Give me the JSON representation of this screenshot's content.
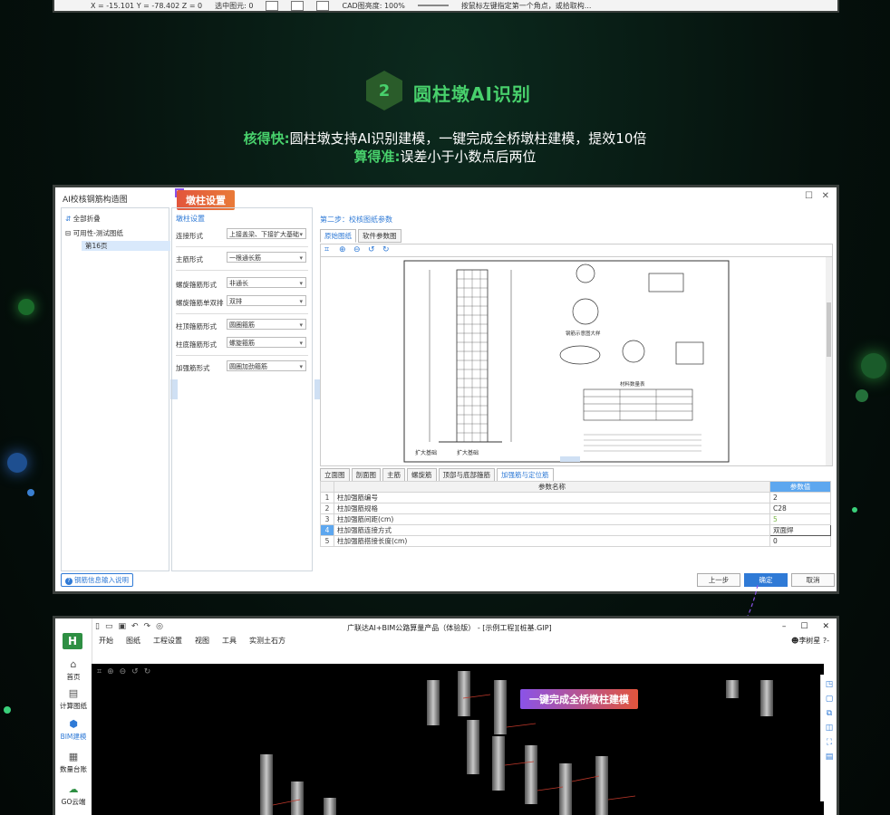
{
  "top_strip": {
    "coords": "X = -15.101 Y = -78.402 Z = 0",
    "selected": "选中图元: 0",
    "brightness": "CAD图亮度: 100%",
    "hint": "按鼠标左键指定第一个角点，或拾取构..."
  },
  "section": {
    "number": "2",
    "title": "圆柱墩AI识别",
    "line1_label": "核得快:",
    "line1_text": "圆柱墩支持AI识别建模，一键完成全桥墩柱建模，提效10倍",
    "line2_label": "算得准:",
    "line2_text": "误差小于小数点后两位"
  },
  "dialog": {
    "title": "AI校核钢筋构造图",
    "tag": "墩柱设置",
    "tree": {
      "collapse_all": "全部折叠",
      "root": "可用性-测试图纸",
      "page": "第16页"
    },
    "settings": {
      "header": "墩柱设置",
      "rows": [
        {
          "label": "连接形式",
          "value": "上接盖梁、下接扩大基础"
        },
        {
          "label": "主筋形式",
          "value": "一根通长筋"
        },
        {
          "label": "螺旋箍筋形式",
          "value": "非通长"
        },
        {
          "label": "螺旋箍筋单双排",
          "value": "双排"
        },
        {
          "label": "柱顶箍筋形式",
          "value": "圆圈箍筋"
        },
        {
          "label": "柱底箍筋形式",
          "value": "螺旋箍筋"
        },
        {
          "label": "加强筋形式",
          "value": "圆圈加劲箍筋"
        }
      ]
    },
    "step": "第二步：校核图纸参数",
    "view_tabs": [
      "原始图纸",
      "软件参数图"
    ],
    "drawing": {
      "detail_title": "钢筋示意图大样",
      "table_title": "材料数量表",
      "labels": [
        "扩大基础",
        "扩大基础"
      ]
    },
    "param_tabs": [
      "立面图",
      "剖面图",
      "主筋",
      "螺旋筋",
      "顶部与底部箍筋",
      "加强筋与定位筋"
    ],
    "active_param_tab": "加强筋与定位筋",
    "table": {
      "col_name": "参数名称",
      "col_value": "参数值",
      "rows": [
        {
          "n": "1",
          "name": "柱加强筋编号",
          "value": "2"
        },
        {
          "n": "2",
          "name": "柱加强筋规格",
          "value": "C28"
        },
        {
          "n": "3",
          "name": "柱加强筋间距(cm)",
          "value": "5"
        },
        {
          "n": "4",
          "name": "柱加强筋连接方式",
          "value": "双面焊"
        },
        {
          "n": "5",
          "name": "柱加强筋搭接长度(cm)",
          "value": "0"
        }
      ]
    },
    "help": "钢筋信息输入说明",
    "buttons": {
      "prev": "上一步",
      "ok": "确定",
      "cancel": "取消"
    }
  },
  "bim": {
    "title": "广联达AI+BIM公路算量产品（体验版） - [示例工程][桩基.GIP]",
    "menu": [
      "开始",
      "图纸",
      "工程设置",
      "视图",
      "工具",
      "实测土石方"
    ],
    "user": "李树星",
    "help": "?-",
    "sidebar": [
      {
        "icon": "⌂",
        "label": "首页"
      },
      {
        "icon": "▤",
        "label": "计算图纸"
      },
      {
        "icon": "⬢",
        "label": "BIM建模"
      },
      {
        "icon": "▦",
        "label": "数量台账"
      },
      {
        "icon": "☁",
        "label": "GO云端"
      }
    ],
    "tag": "一键完成全桥墩柱建模",
    "colors": {
      "accent": "#2f7ad6",
      "green": "#48d16c",
      "tag_orange": "#e2553c",
      "tag_purple": "#8a53e8"
    }
  }
}
